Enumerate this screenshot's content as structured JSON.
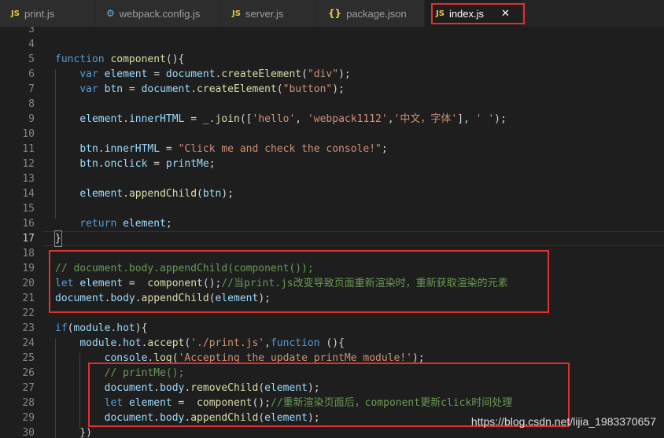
{
  "tabs": [
    {
      "icon": "JS",
      "label": "print.js"
    },
    {
      "icon": "⚙",
      "label": "webpack.config.js"
    },
    {
      "icon": "JS",
      "label": "server.js"
    },
    {
      "icon": "{}",
      "label": "package.json"
    },
    {
      "icon": "JS",
      "label": "index.js",
      "close": "✕"
    }
  ],
  "lines": [
    {
      "n": "3",
      "t": ""
    },
    {
      "n": "4",
      "t": ""
    },
    {
      "n": "5",
      "t": "function component(){"
    },
    {
      "n": "6",
      "t": "    var element = document.createElement(\"div\");"
    },
    {
      "n": "7",
      "t": "    var btn = document.createElement(\"button\");"
    },
    {
      "n": "8",
      "t": ""
    },
    {
      "n": "9",
      "t": "    element.innerHTML = _.join(['hello', 'webpack1112','中文，字体'], ' ');"
    },
    {
      "n": "10",
      "t": ""
    },
    {
      "n": "11",
      "t": "    btn.innerHTML = \"Click me and check the console!\";"
    },
    {
      "n": "12",
      "t": "    btn.onclick = printMe;"
    },
    {
      "n": "13",
      "t": ""
    },
    {
      "n": "14",
      "t": "    element.appendChild(btn);"
    },
    {
      "n": "15",
      "t": ""
    },
    {
      "n": "16",
      "t": "    return element;"
    },
    {
      "n": "17",
      "t": "}"
    },
    {
      "n": "18",
      "t": ""
    },
    {
      "n": "19",
      "t": "// document.body.appendChild(component());"
    },
    {
      "n": "20",
      "t": "let element =  component();//当print.js改变导致页面重新渲染时，重新获取渲染的元素"
    },
    {
      "n": "21",
      "t": "document.body.appendChild(element);"
    },
    {
      "n": "22",
      "t": ""
    },
    {
      "n": "23",
      "t": "if(module.hot){"
    },
    {
      "n": "24",
      "t": "    module.hot.accept('./print.js',function (){"
    },
    {
      "n": "25",
      "t": "        console.log('Accepting the update printMe module!');"
    },
    {
      "n": "26",
      "t": "        // printMe();"
    },
    {
      "n": "27",
      "t": "        document.body.removeChild(element);"
    },
    {
      "n": "28",
      "t": "        let element =  component();//重新渲染页面后，component更新click时间处理"
    },
    {
      "n": "29",
      "t": "        document.body.appendChild(element);"
    },
    {
      "n": "30",
      "t": "    })"
    }
  ],
  "watermark": "https://blog.csdn.net/lijia_1983370657",
  "colors": {
    "annotation_box": "#e03030",
    "background": "#1e1e1e"
  }
}
